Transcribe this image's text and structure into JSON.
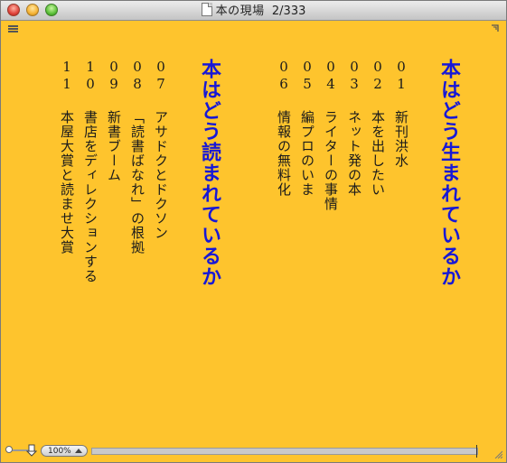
{
  "window": {
    "title": "本の現場",
    "page_indicator": "2/333",
    "background": "#fec42d"
  },
  "toolbar": {
    "menu_icon": "hamburger-icon",
    "corner_icon": "corner-arrow-icon"
  },
  "sections": [
    {
      "heading": "本はどう生まれているか",
      "items": [
        {
          "num": "01",
          "title": "新刊洪水"
        },
        {
          "num": "02",
          "title": "本を出したい"
        },
        {
          "num": "03",
          "title": "ネット発の本"
        },
        {
          "num": "04",
          "title": "ライターの事情"
        },
        {
          "num": "05",
          "title": "編プロのいま"
        },
        {
          "num": "06",
          "title": "情報の無料化"
        }
      ]
    },
    {
      "heading": "本はどう読まれているか",
      "items": [
        {
          "num": "07",
          "title": "アサドクとドクソン"
        },
        {
          "num": "08",
          "title": "「読書ばなれ」の根拠"
        },
        {
          "num": "09",
          "title": "新書ブーム"
        },
        {
          "num": "10",
          "title": "書店をディレクションする"
        },
        {
          "num": "11",
          "title": "本屋大賞と読ませ大賞"
        }
      ]
    }
  ],
  "statusbar": {
    "zoom_label": "100%",
    "progress_fraction": 0.0
  },
  "colors": {
    "heading": "#1718d6",
    "text": "#1b1b1b"
  }
}
